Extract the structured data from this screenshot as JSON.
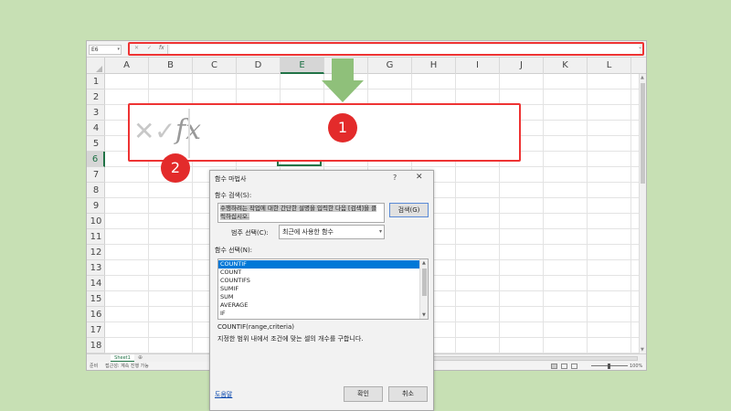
{
  "namebox": {
    "value": "E6"
  },
  "formula_bar": {
    "cancel": "✕",
    "enter": "✓",
    "fx": "fx",
    "value": ""
  },
  "columns": [
    "A",
    "B",
    "C",
    "D",
    "E",
    "F",
    "G",
    "H",
    "I",
    "J",
    "K",
    "L"
  ],
  "rows": [
    "1",
    "2",
    "3",
    "4",
    "5",
    "6",
    "7",
    "8",
    "9",
    "10",
    "11",
    "12",
    "13",
    "14",
    "15",
    "16",
    "17",
    "18"
  ],
  "selected": {
    "column": "E",
    "row": "6"
  },
  "zoom_callout": {
    "cancel": "✕",
    "enter": "✓",
    "fx": "fx"
  },
  "badges": {
    "one": "1",
    "two": "2"
  },
  "sheet": {
    "tab": "Sheet1",
    "add": "⊕"
  },
  "status": {
    "mode": "준비",
    "accessibility": "접근성: 계속 진행 가능",
    "zoom": "100%"
  },
  "dialog": {
    "title": "함수 마법사",
    "help": "?",
    "close": "✕",
    "search_label": "함수 검색(S):",
    "search_text": "수행하려는 작업에 대한 간단한 설명을 입력한 다음 [검색]을 클릭하십시오.",
    "search_button": "검색(G)",
    "category_label": "범주 선택(C):",
    "category_value": "최근에 사용한 함수",
    "function_list_label": "함수 선택(N):",
    "functions": [
      "COUNTIF",
      "COUNT",
      "COUNTIFS",
      "SUMIF",
      "SUM",
      "AVERAGE",
      "IF"
    ],
    "selected_function": "COUNTIF",
    "syntax": "COUNTIF(range,criteria)",
    "description": "지정한 범위 내에서 조건에 맞는 셀의 개수를 구합니다.",
    "help_link": "도움말",
    "ok": "확인",
    "cancel": "취소"
  },
  "colors": {
    "highlight": "#e33333",
    "arrow": "#8fc07a",
    "excel_green": "#217346",
    "list_select": "#0078d7"
  }
}
